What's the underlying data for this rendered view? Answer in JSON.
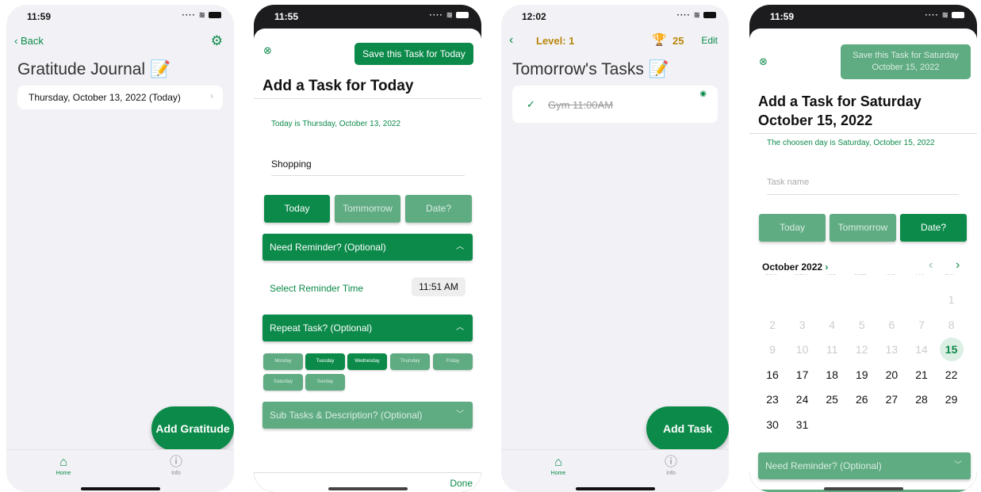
{
  "screen1": {
    "status_time": "11:59",
    "back_label": "Back",
    "title": "Gratitude Journal",
    "title_emoji": "📝",
    "entry_label": "Thursday, October 13, 2022 (Today)",
    "fab_label": "Add Gratitude",
    "tabs": [
      {
        "label": "Home",
        "icon": "house-icon"
      },
      {
        "label": "Info",
        "icon": "info-icon"
      }
    ]
  },
  "screen2": {
    "status_time": "11:55",
    "save_label": "Save this Task for Today",
    "title": "Add a Task for Today",
    "today_text": "Today is Thursday, October 13, 2022",
    "task_value": "Shopping",
    "date_options": [
      "Today",
      "Tommorrow",
      "Date?"
    ],
    "reminder_header": "Need Reminder? (Optional)",
    "reminder_label": "Select Reminder Time",
    "reminder_time": "11:51 AM",
    "repeat_header": "Repeat Task? (Optional)",
    "days": [
      "Monday",
      "Tuesday",
      "Wednesday",
      "Thursday",
      "Friday",
      "Saturday",
      "Sunday"
    ],
    "days_selected": [
      "Tuesday",
      "Wednesday"
    ],
    "subtasks_header": "Sub Tasks & Description? (Optional)",
    "done_label": "Done"
  },
  "screen3": {
    "status_time": "12:02",
    "level_label": "Level: 1",
    "score": "25",
    "edit_label": "Edit",
    "title": "Tomorrow's Tasks",
    "title_emoji": "📝",
    "task_label": "Gym 11:00AM",
    "fab_label": "Add Task",
    "tabs": [
      {
        "label": "Home",
        "icon": "house-icon"
      },
      {
        "label": "Info",
        "icon": "info-icon"
      }
    ]
  },
  "screen4": {
    "status_time": "11:59",
    "save_line1": "Save this Task for Saturday",
    "save_line2": "October 15, 2022",
    "title_line1": "Add a Task for Saturday",
    "title_line2": "October 15, 2022",
    "chosen_text": "The choosen day is Saturday, October 15, 2022",
    "task_placeholder": "Task name",
    "date_options": [
      "Today",
      "Tommorrow",
      "Date?"
    ],
    "month_label": "October 2022",
    "weekdays": [
      "SUN",
      "MON",
      "TUE",
      "WED",
      "THU",
      "FRI",
      "SAT"
    ],
    "calendar_rows": [
      [
        "",
        "",
        "",
        "",
        "",
        "",
        "1"
      ],
      [
        "2",
        "3",
        "4",
        "5",
        "6",
        "7",
        "8"
      ],
      [
        "9",
        "10",
        "11",
        "12",
        "13",
        "14",
        "15"
      ],
      [
        "16",
        "17",
        "18",
        "19",
        "20",
        "21",
        "22"
      ],
      [
        "23",
        "24",
        "25",
        "26",
        "27",
        "28",
        "29"
      ],
      [
        "30",
        "31",
        "",
        "",
        "",
        "",
        ""
      ]
    ],
    "selected_day": "15",
    "reminder_header": "Need Reminder? (Optional)"
  },
  "colors": {
    "accent": "#0c8a4a",
    "accent_light": "#5fab82",
    "gold": "#b8860b"
  }
}
